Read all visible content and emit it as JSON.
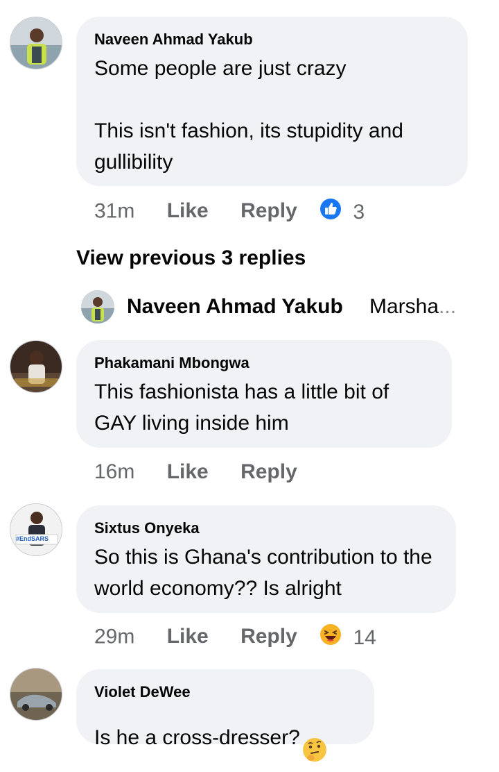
{
  "comments": [
    {
      "author": "Naveen Ahmad Yakub",
      "text": "Some people are just crazy\n\nThis isn't fashion, its stupidity and gullibility",
      "time": "31m",
      "like": "Like",
      "reply": "Reply",
      "reaction": {
        "icon": "like-icon",
        "count": "3",
        "color": "#1877f2"
      }
    },
    {
      "author": "Phakamani Mbongwa",
      "text": "This fashionista has a little bit of GAY living inside him",
      "time": "16m",
      "like": "Like",
      "reply": "Reply"
    },
    {
      "author": "Sixtus Onyeka",
      "text": "So this is Ghana's contribution to the world economy?? Is alright",
      "time": "29m",
      "like": "Like",
      "reply": "Reply",
      "reaction": {
        "icon": "haha-icon",
        "count": "14",
        "color": "#f7b125"
      }
    },
    {
      "author": "Violet DeWee",
      "text": "Is he a cross-dresser?",
      "emoji": "thinking-face-icon"
    }
  ],
  "view_previous": "View previous 3 replies",
  "reply_preview": {
    "author": "Naveen Ahmad Yakub",
    "text": "Marsha",
    "ellipsis": "..."
  },
  "avatar_badge": "#EndSARS"
}
